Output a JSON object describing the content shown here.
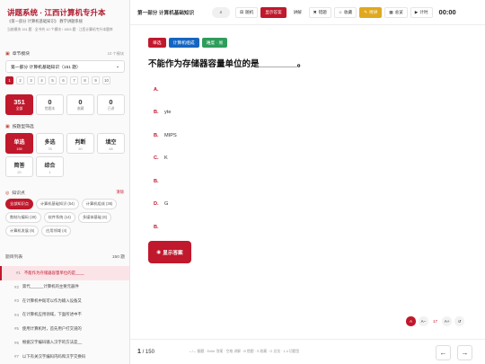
{
  "app": {
    "title": "讲题系统 · 江西计算机专升本",
    "subtitle": "《第一部分 计算机基础知识》 教学讲题系统",
    "meta": "当前模块 151 题 · 全书共 10 个模块 / 1503 题 · 江西计算机专升本题库"
  },
  "chapter": {
    "label": "章节模块",
    "count": "10 个模块",
    "selected": "第一部分 计算机基础知识（151 题）",
    "pages": [
      "1",
      "2",
      "3",
      "4",
      "5",
      "6",
      "7",
      "8",
      "9",
      "10"
    ]
  },
  "stats": [
    {
      "n": "351",
      "l": "全部"
    },
    {
      "n": "0",
      "l": "错题本"
    },
    {
      "n": "0",
      "l": "收藏"
    },
    {
      "n": "0",
      "l": "已讲"
    }
  ],
  "types": {
    "label": "按题型筛选",
    "items": [
      {
        "n": "单选",
        "c": "159"
      },
      {
        "n": "多选",
        "c": "78"
      },
      {
        "n": "判断",
        "c": "50"
      },
      {
        "n": "填空",
        "c": "68"
      },
      {
        "n": "简答",
        "c": "20"
      },
      {
        "n": "综合",
        "c": "1"
      }
    ]
  },
  "knowledge": {
    "label": "知识点",
    "clear": "清除",
    "tags": [
      "全部知识点",
      "计算机基础知识 (54)",
      "计算机组成 (36)",
      "数制与编码 (30)",
      "软件系统 (14)",
      "多媒体基础 (6)",
      "计算机发展 (6)",
      "应用领域 (4)"
    ]
  },
  "list": {
    "label": "题目列表",
    "count": "150 题",
    "items": [
      {
        "no": "#1",
        "text": "不能作为存储器容量单位的是____"
      },
      {
        "no": "#2",
        "text": "第代______计算机的主要元器件"
      },
      {
        "no": "#3",
        "text": "在计算机中既可以作为输入设备又"
      },
      {
        "no": "#4",
        "text": "在计算机应用领域，下面所述中不"
      },
      {
        "no": "#5",
        "text": "使用计算机时，首先用户打交道的"
      },
      {
        "no": "#6",
        "text": "根据汉字编码输入汉字的方法是__"
      },
      {
        "no": "#7",
        "text": "以下有关汉字编码内码和汉字交换码"
      }
    ]
  },
  "topbar": {
    "title": "第一部分 计算机基础知识",
    "search_icon": "search-icon",
    "buttons": [
      "随机",
      "显示答案",
      "讲解",
      "错题",
      "收藏",
      "待讲",
      "总览",
      "计时"
    ],
    "timer": "00:00"
  },
  "question": {
    "badges": [
      {
        "text": "单选",
        "color": "#c0182c"
      },
      {
        "text": "计算机组成",
        "color": "#1565c0"
      },
      {
        "text": "难度 · 易",
        "color": "#2e9d5b"
      }
    ],
    "title": "不能作为存储器容量单位的是________。",
    "options": [
      {
        "k": "A.",
        "t": ""
      },
      {
        "k": "B.",
        "t": "yte"
      },
      {
        "k": "B.",
        "t": "MIPS"
      },
      {
        "k": "C.",
        "t": "K"
      },
      {
        "k": "B.",
        "t": ""
      },
      {
        "k": "D.",
        "t": "G"
      },
      {
        "k": "B.",
        "t": ""
      }
    ],
    "show_answer": "显示答案"
  },
  "fonttools": {
    "a": "A",
    "minus": "A−",
    "size": "17",
    "plus": "A+",
    "reset": "↺"
  },
  "bottom": {
    "page": "1",
    "total": "/ 150",
    "hint": "←/→ 翻题 · Enter 答案 · 空格 讲解 · B 错题 · S 收藏 · G 总览 · 1-4 切题型",
    "prev": "←",
    "next": "→"
  },
  "colors": {
    "accent": "#c0182c",
    "warn": "#e0a81e"
  }
}
